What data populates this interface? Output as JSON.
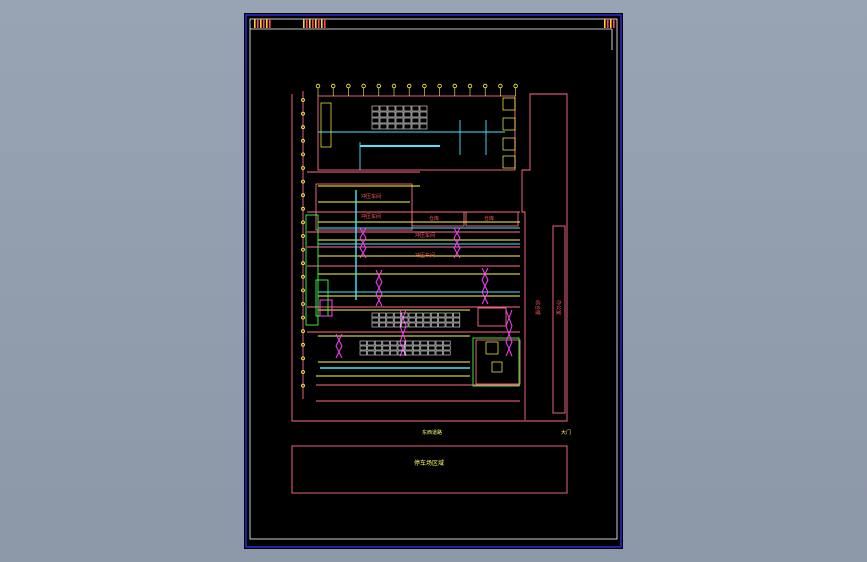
{
  "viewer": {
    "background": "#929dae"
  },
  "sheet": {
    "paper_color": "#000000",
    "frame_color": "#2a2ad8",
    "inner_frame_color": "#ffffff"
  },
  "palette": {
    "wall": "#ff6b8a",
    "line_yellow": "#ffff3a",
    "line_green": "#3cff3c",
    "line_cyan": "#44e8ff",
    "line_magenta": "#ff3cff",
    "line_white": "#e8e8e8",
    "label_red": "#ff5a5a",
    "label_yellow": "#ffff66"
  },
  "labels": {
    "workshop_1": "冲压车间",
    "workshop_2": "冲压车间",
    "workshop_3": "冲压车间",
    "workshop_4": "冲压车间",
    "store_a": "仓库",
    "store_b": "仓库",
    "office_right": "办公室",
    "office_left": "综合楼",
    "road": "东西道路",
    "gate": "大门",
    "parking": "停车场区域"
  }
}
